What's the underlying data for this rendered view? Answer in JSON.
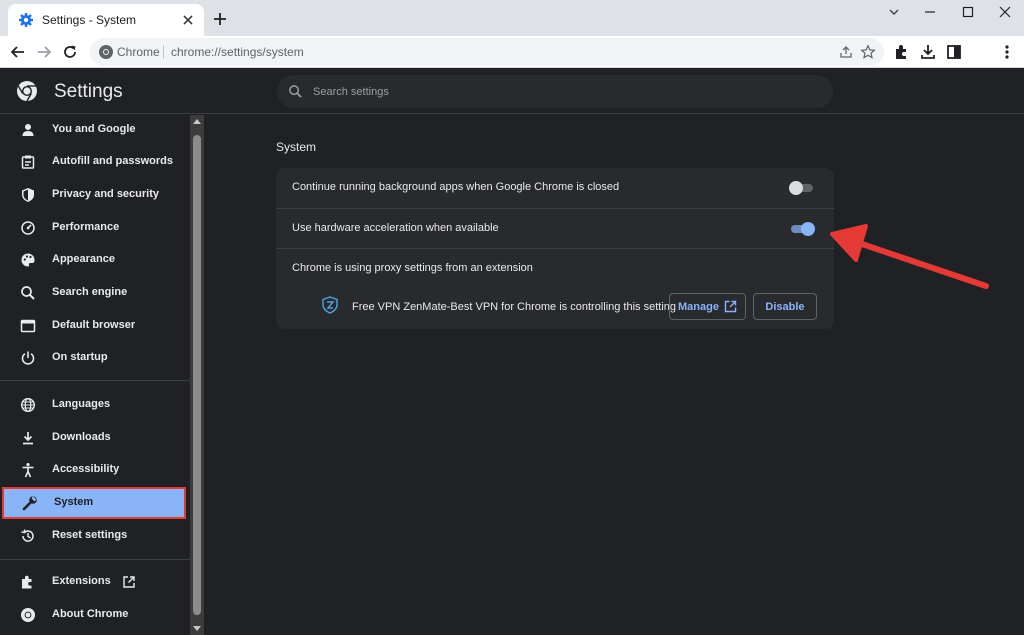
{
  "browser": {
    "tab_title": "Settings - System",
    "omnibox_chip": "Chrome",
    "url": "chrome://settings/system"
  },
  "header": {
    "title": "Settings",
    "search_placeholder": "Search settings"
  },
  "sidebar": {
    "items": [
      {
        "label": "You and Google",
        "icon": "person-icon"
      },
      {
        "label": "Autofill and passwords",
        "icon": "clipboard-icon"
      },
      {
        "label": "Privacy and security",
        "icon": "shield-icon"
      },
      {
        "label": "Performance",
        "icon": "gauge-icon"
      },
      {
        "label": "Appearance",
        "icon": "palette-icon"
      },
      {
        "label": "Search engine",
        "icon": "search-icon"
      },
      {
        "label": "Default browser",
        "icon": "browser-window-icon"
      },
      {
        "label": "On startup",
        "icon": "power-icon"
      },
      {
        "label": "Languages",
        "icon": "globe-icon"
      },
      {
        "label": "Downloads",
        "icon": "download-icon"
      },
      {
        "label": "Accessibility",
        "icon": "accessibility-icon"
      },
      {
        "label": "System",
        "icon": "wrench-icon",
        "active": true
      },
      {
        "label": "Reset settings",
        "icon": "restore-icon"
      },
      {
        "label": "Extensions",
        "icon": "puzzle-icon"
      },
      {
        "label": "About Chrome",
        "icon": "chrome-icon"
      }
    ]
  },
  "main": {
    "section_title": "System",
    "settings": [
      {
        "label": "Continue running background apps when Google Chrome is closed",
        "enabled": false
      },
      {
        "label": "Use hardware acceleration when available",
        "enabled": true
      }
    ],
    "proxy_notice": "Chrome is using proxy settings from an extension",
    "extension_control": {
      "text": "Free VPN ZenMate-Best VPN for Chrome is controlling this setting",
      "manage_label": "Manage",
      "disable_label": "Disable"
    }
  },
  "colors": {
    "accent": "#8ab4f8",
    "background": "#202124",
    "card": "#292a2d",
    "highlight_border": "#e53935",
    "annotation_arrow": "#e53935"
  }
}
